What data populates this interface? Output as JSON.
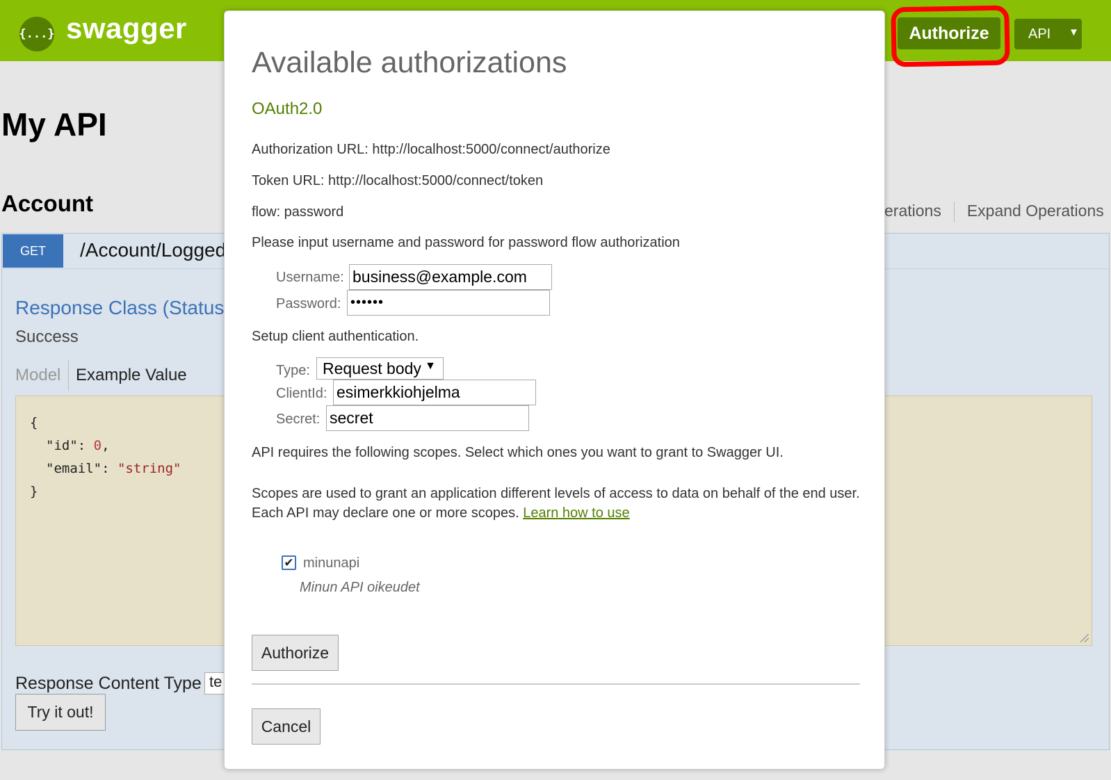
{
  "header": {
    "logo_glyph": "{...}",
    "logo_text": "swagger",
    "authorize_label": "Authorize",
    "api_select_value": "API",
    "api_select_arrow": "▼",
    "brand_color": "#89bf04",
    "button_color": "#547f00",
    "highlight_color": "#ff0000"
  },
  "page": {
    "title": "My API",
    "section": "Account",
    "ops_partial": "erations",
    "ops_expand": "Expand Operations"
  },
  "endpoint": {
    "method": "GET",
    "method_color": "#3b73b9",
    "path": "/Account/Logged",
    "response_class": "Response Class (Status",
    "status_text": "Success",
    "tab_model": "Model",
    "tab_example": "Example Value",
    "code_lines": [
      "{",
      "\"id\": ",
      "0",
      ",",
      "\"email\": ",
      "\"string\"",
      "}"
    ],
    "content_type_label": "Response Content Type",
    "content_type_value": "te",
    "try_button": "Try it out!"
  },
  "modal": {
    "title": "Available authorizations",
    "scheme": "OAuth2.0",
    "auth_url": "Authorization URL: http://localhost:5000/connect/authorize",
    "token_url": "Token URL: http://localhost:5000/connect/token",
    "flow": "flow: password",
    "password_prompt": "Please input username and password for password flow authorization",
    "username_label": "Username:",
    "username_value": "business@example.com",
    "password_label": "Password:",
    "password_value": "••••••",
    "client_setup": "Setup client authentication.",
    "type_label": "Type:",
    "type_value": "Request body",
    "type_arrow": "▼",
    "clientid_label": "ClientId:",
    "clientid_value": "esimerkkiohjelma",
    "secret_label": "Secret:",
    "secret_value": "secret",
    "scopes_intro": "API requires the following scopes. Select which ones you want to grant to Swagger UI.",
    "scopes_text": "Scopes are used to grant an application different levels of access to data on behalf of the end user. Each API may declare one or more scopes.",
    "learn_link": "Learn how to use",
    "scope": {
      "name": "minunapi",
      "description": "Minun API oikeudet",
      "checked": true,
      "check_glyph": "✔"
    },
    "authorize_button": "Authorize",
    "cancel_button": "Cancel"
  }
}
